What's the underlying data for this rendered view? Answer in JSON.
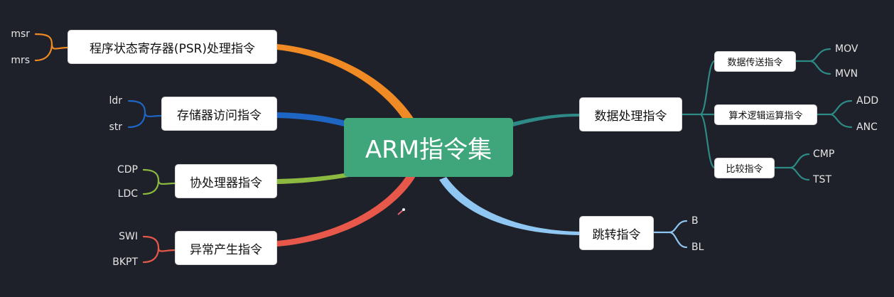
{
  "root": {
    "label": "ARM指令集"
  },
  "colors": {
    "background": "#1e2129",
    "root_fill": "#3fa57a",
    "psr_branch": "#f08a24",
    "memory_branch": "#1f66c4",
    "coprocessor_branch": "#8cba40",
    "exception_branch": "#e8584a",
    "data_branch": "#2e8a86",
    "jump_branch": "#8fc7f2"
  },
  "left_branches": [
    {
      "label": "程序状态寄存器(PSR)处理指令",
      "children": [
        "msr",
        "mrs"
      ]
    },
    {
      "label": "存储器访问指令",
      "children": [
        "ldr",
        "str"
      ]
    },
    {
      "label": "协处理器指令",
      "children": [
        "CDP",
        "LDC"
      ]
    },
    {
      "label": "异常产生指令",
      "children": [
        "SWI",
        "BKPT"
      ]
    }
  ],
  "right_branches": [
    {
      "label": "数据处理指令",
      "sub": [
        {
          "label": "数据传送指令",
          "children": [
            "MOV",
            "MVN"
          ]
        },
        {
          "label": "算术逻辑运算指令",
          "children": [
            "ADD",
            "ANC"
          ]
        },
        {
          "label": "比较指令",
          "children": [
            "CMP",
            "TST"
          ]
        }
      ]
    },
    {
      "label": "跳转指令",
      "children": [
        "B",
        "BL"
      ]
    }
  ]
}
